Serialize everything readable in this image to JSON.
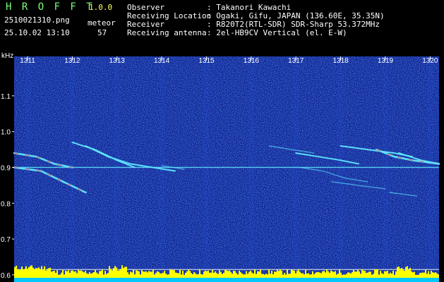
{
  "header": {
    "app_name": "H R O F F T",
    "version": "1.0.0",
    "filename": "2510021310.png",
    "datetime": "25.10.02 13:10",
    "meteor_label": "meteor",
    "meteor_count": "57",
    "info": [
      {
        "label": "Observer",
        "value": ": Takanori Kawachi"
      },
      {
        "label": "Receiving Location",
        "value": ": Ogaki, Gifu, JAPAN (136.60E, 35.35N)"
      },
      {
        "label": "Receiver",
        "value": ": R820T2(RTL-SDR) SDR-Sharp 53.372MHz"
      },
      {
        "label": "Receiving antenna",
        "value": ": 2el-HB9CV Vertical (el. E-W)"
      }
    ]
  },
  "colors": {
    "background": "#000000",
    "text": "#ffffff",
    "title": "#7dff7d",
    "accent": "#ffff66",
    "noise_base": "#0b1a8a",
    "echo": "#5fe8ff",
    "echo_hot": "#ff4040",
    "level_bar": "#ffff00",
    "level_base": "#00c8ff"
  },
  "chart_data": {
    "type": "heatmap",
    "title": "",
    "xlabel": "",
    "ylabel": "kHz",
    "x_ticks": [
      "1311",
      "1312",
      "1313",
      "1314",
      "1315",
      "1316",
      "1317",
      "1318",
      "1319",
      "1320"
    ],
    "x_range": [
      1310.7,
      1320.2
    ],
    "y_ticks": [
      "1.1",
      "1.0",
      "0.9",
      "0.8",
      "0.7",
      "0.6"
    ],
    "ylim": [
      0.58,
      1.21
    ],
    "carrier_khz": 0.9,
    "echoes": [
      {
        "x": [
          1310.7,
          1311.2,
          1311.6,
          1312.0
        ],
        "y": [
          0.94,
          0.93,
          0.91,
          0.9
        ],
        "strength": "strong"
      },
      {
        "x": [
          1310.7,
          1311.3,
          1311.8,
          1312.3
        ],
        "y": [
          0.9,
          0.89,
          0.86,
          0.83
        ],
        "strength": "strong"
      },
      {
        "x": [
          1312.0,
          1312.5,
          1313.0,
          1313.4
        ],
        "y": [
          0.97,
          0.95,
          0.92,
          0.9
        ],
        "strength": "medium"
      },
      {
        "x": [
          1312.3,
          1312.8,
          1313.3,
          1313.8,
          1314.3
        ],
        "y": [
          0.96,
          0.93,
          0.91,
          0.9,
          0.89
        ],
        "strength": "medium"
      },
      {
        "x": [
          1314.0,
          1314.5
        ],
        "y": [
          0.905,
          0.895
        ],
        "strength": "weak"
      },
      {
        "x": [
          1316.4,
          1316.9,
          1317.4
        ],
        "y": [
          0.96,
          0.95,
          0.94
        ],
        "strength": "weak"
      },
      {
        "x": [
          1317.0,
          1317.5,
          1318.0,
          1318.4
        ],
        "y": [
          0.94,
          0.93,
          0.92,
          0.91
        ],
        "strength": "medium"
      },
      {
        "x": [
          1317.1,
          1317.6,
          1318.1,
          1318.6
        ],
        "y": [
          0.9,
          0.89,
          0.87,
          0.86
        ],
        "strength": "weak"
      },
      {
        "x": [
          1318.0,
          1318.6,
          1319.2,
          1319.6
        ],
        "y": [
          0.96,
          0.95,
          0.94,
          0.93
        ],
        "strength": "medium"
      },
      {
        "x": [
          1318.8,
          1319.2,
          1319.6,
          1320.2
        ],
        "y": [
          0.95,
          0.93,
          0.92,
          0.91
        ],
        "strength": "strong"
      },
      {
        "x": [
          1319.3,
          1319.8,
          1320.2
        ],
        "y": [
          0.94,
          0.92,
          0.91
        ],
        "strength": "medium"
      },
      {
        "x": [
          1317.8,
          1318.4,
          1319.0
        ],
        "y": [
          0.86,
          0.85,
          0.84
        ],
        "strength": "weak"
      },
      {
        "x": [
          1319.1,
          1319.7
        ],
        "y": [
          0.83,
          0.82
        ],
        "strength": "weak"
      }
    ],
    "level_meter": {
      "min_kHz": 0.58,
      "threshold_kHz": 0.615
    }
  }
}
